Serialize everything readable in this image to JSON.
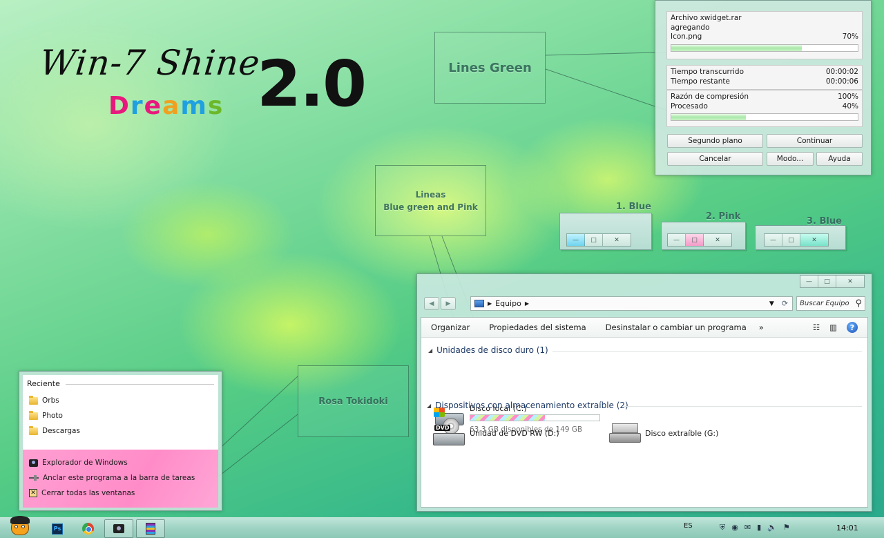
{
  "title_art": {
    "script": "Win-7 Shine",
    "version": "2.0",
    "subtitle_letters": [
      "D",
      "r",
      "e",
      "a",
      "m",
      "s"
    ]
  },
  "annotations": {
    "lines_green": "Lines Green",
    "lineas_line1": "Lineas",
    "lineas_line2": "Blue green and Pink",
    "rosa": "Rosa Tokidoki"
  },
  "variants": [
    {
      "label": "1. Blue"
    },
    {
      "label": "2. Pink"
    },
    {
      "label": "3. Blue"
    }
  ],
  "caption_glyphs": {
    "minimize": "—",
    "maximize": "□",
    "close": "✕"
  },
  "progress_dialog": {
    "archive_line": "Archivo xwidget.rar",
    "action_line": "agregando",
    "file_name": "Icon.png",
    "file_percent": "70%",
    "file_progress": 0.7,
    "elapsed_label": "Tiempo transcurrido",
    "elapsed_value": "00:00:02",
    "remaining_label": "Tiempo restante",
    "remaining_value": "00:00:06",
    "ratio_label": "Razón de compresión",
    "ratio_value": "100%",
    "processed_label": "Procesado",
    "processed_value": "40%",
    "processed_progress": 0.4,
    "buttons": {
      "background": "Segundo plano",
      "continue": "Continuar",
      "cancel": "Cancelar",
      "mode": "Modo...",
      "help": "Ayuda"
    }
  },
  "jump_list": {
    "recent_header": "Reciente",
    "recent_items": [
      "Orbs",
      "Photo",
      "Descargas"
    ],
    "tasks": [
      "Explorador de Windows",
      "Anclar este programa a la barra de tareas",
      "Cerrar todas las ventanas"
    ],
    "task_close_glyph": "✕"
  },
  "explorer": {
    "nav_back": "◀",
    "nav_forward": "▶",
    "address_sep": "▶",
    "address_crumb": "Equipo",
    "address_dropdown": "▼",
    "address_refresh": "⟳",
    "search_placeholder": "Buscar Equipo",
    "search_icon": "⚲",
    "toolbar": {
      "organize": "Organizar",
      "system_properties": "Propiedades del sistema",
      "uninstall": "Desinstalar o cambiar un programa",
      "more": "»",
      "view_glyph": "☷",
      "pane_glyph": "▥",
      "help_glyph": "?"
    },
    "group_hdd": "Unidades de disco duro (1)",
    "group_removable": "Dispositivos con almacenamiento extraíble (2)",
    "group_toggle": "◢",
    "drive_c_name": "Disco local (C:)",
    "drive_c_free": "63,3 GB disponibles de 149 GB",
    "drive_c_used_fraction": 0.575,
    "drive_dvd_name": "Unidad de DVD RW (D:)",
    "drive_dvd_label": "DVD",
    "drive_g_name": "Disco extraíble (G:)"
  },
  "taskbar": {
    "ps_label": "Ps",
    "language": "ES",
    "tray_glyphs": [
      "⛨",
      "◉",
      "✉",
      "▮",
      "🔈",
      "⚑"
    ],
    "clock": "14:01"
  },
  "colors": {
    "accent_green": "#a9e8a9",
    "jumplist_pink": "#ff8cc8",
    "frame_teal": "#c8e8de"
  }
}
